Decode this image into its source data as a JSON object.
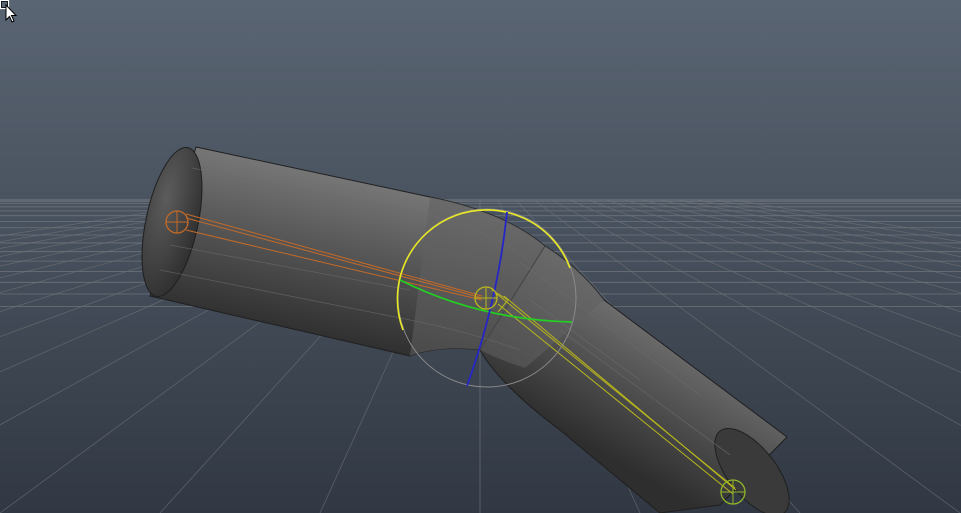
{
  "viewport": {
    "background_top": "#5a6573",
    "background_bottom": "#313843",
    "grid_color": "#6e737a",
    "grid_major_color": "#7c8087"
  },
  "mesh": {
    "shade_light": "#7a7a7a",
    "shade_mid": "#575757",
    "shade_dark": "#2e2e2e",
    "edge_color": "#1f1f1f"
  },
  "skeleton": {
    "root_joint_color": "#c46a28",
    "child_joint_color": "#b9b71c",
    "end_joint_color": "#8fb52a"
  },
  "rotate_manipulator": {
    "x_ring_color": "#e8e824",
    "y_ring_color": "#22d022",
    "z_ring_color": "#2626c8",
    "view_ring_color": "#8a8a8a"
  },
  "cursor": {
    "icon": "arrow-with-box-cursor-icon",
    "color": "#ffffff"
  }
}
